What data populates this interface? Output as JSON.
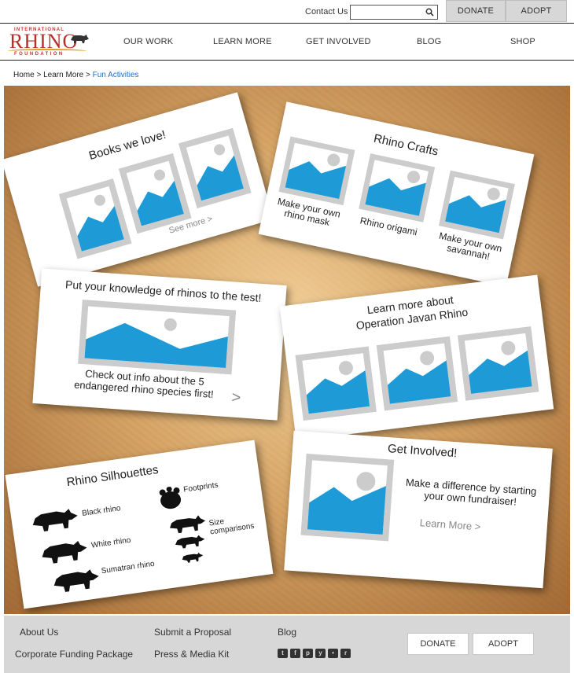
{
  "topbar": {
    "contact_label": "Contact Us",
    "search_value": "",
    "donate_label": "DONATE",
    "adopt_label": "ADOPT"
  },
  "logo": {
    "line1": "INTERNATIONAL",
    "line2": "RHINO",
    "line3": "FOUNDATION"
  },
  "nav": {
    "items": [
      {
        "label": "OUR WORK"
      },
      {
        "label": "LEARN MORE"
      },
      {
        "label": "GET INVOLVED"
      },
      {
        "label": "BLOG"
      },
      {
        "label": "SHOP"
      }
    ]
  },
  "breadcrumb": {
    "home": "Home",
    "sep": ">",
    "learn": "Learn More",
    "current": "Fun Activities"
  },
  "cards": {
    "books": {
      "title": "Books we love!",
      "more": "See more >"
    },
    "crafts": {
      "title": "Rhino Crafts",
      "items": [
        {
          "label": "Make your own rhino mask"
        },
        {
          "label": "Rhino origami"
        },
        {
          "label": "Make your own savannah!"
        }
      ]
    },
    "quiz": {
      "title": "Put your knowledge of rhinos to the test!",
      "text": "Check out info about the 5 endangered rhino species first!",
      "arrow": ">"
    },
    "javan": {
      "title_line1": "Learn more about",
      "title_line2": "Operation Javan Rhino"
    },
    "silhouettes": {
      "title": "Rhino Silhouettes",
      "labels": {
        "black": "Black rhino",
        "white": "White rhino",
        "sumatran": "Sumatran rhino",
        "footprints": "Footprints",
        "size": "Size comparisons"
      }
    },
    "involved": {
      "title": "Get Involved!",
      "text": "Make a difference by starting your own fundraiser!",
      "more": "Learn More >"
    }
  },
  "footer": {
    "about": "About Us",
    "corporate": "Corporate Funding Package",
    "proposal": "Submit a Proposal",
    "press": "Press & Media Kit",
    "blog": "Blog",
    "donate_label": "DONATE",
    "adopt_label": "ADOPT",
    "social": [
      {
        "icon": "twitter-icon",
        "glyph": "t"
      },
      {
        "icon": "facebook-icon",
        "glyph": "f"
      },
      {
        "icon": "pinterest-icon",
        "glyph": "p"
      },
      {
        "icon": "youtube-icon",
        "glyph": "y"
      },
      {
        "icon": "flickr-icon",
        "glyph": "•"
      },
      {
        "icon": "rss-icon",
        "glyph": "r"
      }
    ]
  },
  "colors": {
    "accent": "#1a6fd1",
    "photo_blue": "#1e9ad6",
    "photo_frame": "#cccccc",
    "logo_red": "#b5302a"
  }
}
